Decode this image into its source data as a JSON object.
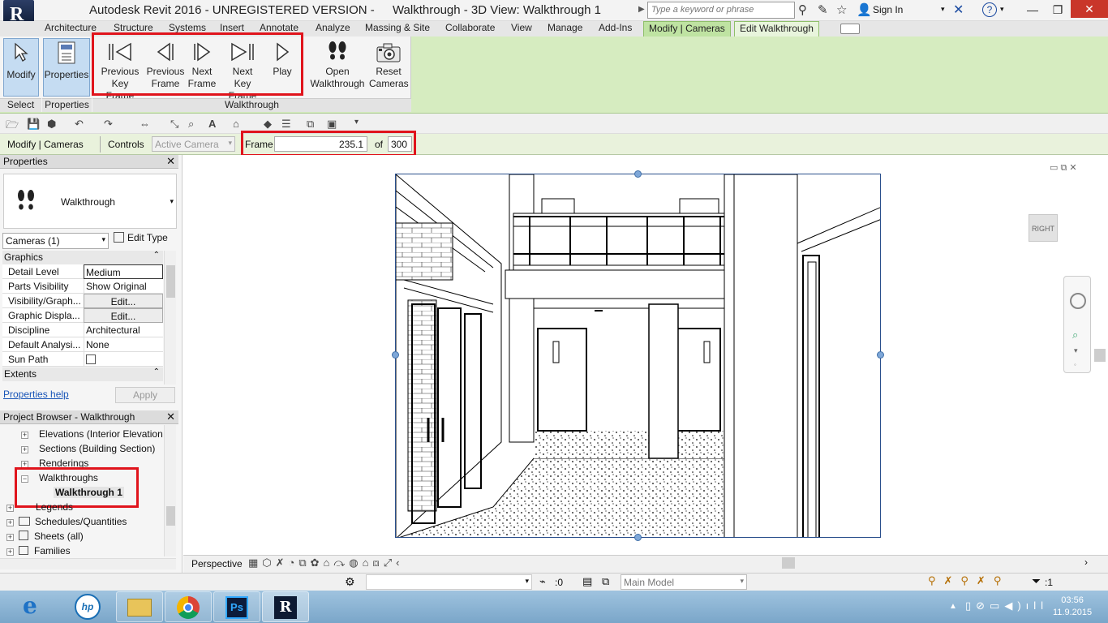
{
  "titlebar": {
    "app_title": "Autodesk Revit 2016 - UNREGISTERED VERSION -",
    "doc_title": "Walkthrough - 3D View: Walkthrough 1",
    "search_placeholder": "Type a keyword or phrase",
    "signin_label": "Sign In"
  },
  "tabs": [
    "Architecture",
    "Structure",
    "Systems",
    "Insert",
    "Annotate",
    "Analyze",
    "Massing & Site",
    "Collaborate",
    "View",
    "Manage",
    "Add-Ins",
    "Modify | Cameras",
    "Edit Walkthrough"
  ],
  "ribbon": {
    "modify_label": "Modify",
    "properties_label": "Properties",
    "prev_key_frame": [
      "Previous",
      "Key Frame"
    ],
    "prev_frame": [
      "Previous",
      "Frame"
    ],
    "next_frame": [
      "Next",
      "Frame"
    ],
    "next_key_frame": [
      "Next",
      "Key Frame"
    ],
    "play": "Play",
    "open_walkthrough": [
      "Open",
      "Walkthrough"
    ],
    "reset_cameras": [
      "Reset",
      "Cameras"
    ],
    "panel_select": "Select",
    "panel_properties": "Properties",
    "panel_walkthrough": "Walkthrough"
  },
  "options_bar": {
    "context": "Modify | Cameras",
    "controls_label": "Controls",
    "controls_value": "Active Camera",
    "frame_label": "Frame",
    "frame_value": "235.1",
    "of_label": "of",
    "total_frames": "300"
  },
  "properties": {
    "header": "Properties",
    "type_name": "Walkthrough",
    "category_selector": "Cameras (1)",
    "edit_type": "Edit Type",
    "group_graphics": "Graphics",
    "rows": [
      {
        "key": "Detail Level",
        "value": "Medium"
      },
      {
        "key": "Parts Visibility",
        "value": "Show Original"
      },
      {
        "key": "Visibility/Graph...",
        "value": "Edit..."
      },
      {
        "key": "Graphic Displa...",
        "value": "Edit..."
      },
      {
        "key": "Discipline",
        "value": "Architectural"
      },
      {
        "key": "Default Analysi...",
        "value": "None"
      },
      {
        "key": "Sun Path",
        "value": ""
      }
    ],
    "group_extents": "Extents",
    "help_link": "Properties help",
    "apply": "Apply"
  },
  "project_browser": {
    "header": "Project Browser - Walkthrough",
    "items": [
      "Elevations (Interior Elevation",
      "Sections (Building Section)",
      "Renderings",
      "Walkthroughs",
      "Walkthrough 1",
      "Legends",
      "Schedules/Quantities",
      "Sheets (all)",
      "Families"
    ]
  },
  "viewcube_label": "RIGHT",
  "view_control": {
    "mode": "Perspective"
  },
  "status": {
    "count": ":0",
    "model": "Main Model",
    "filter_count": ":1"
  },
  "clock": {
    "time": "03:56",
    "date": "11.9.2015"
  }
}
